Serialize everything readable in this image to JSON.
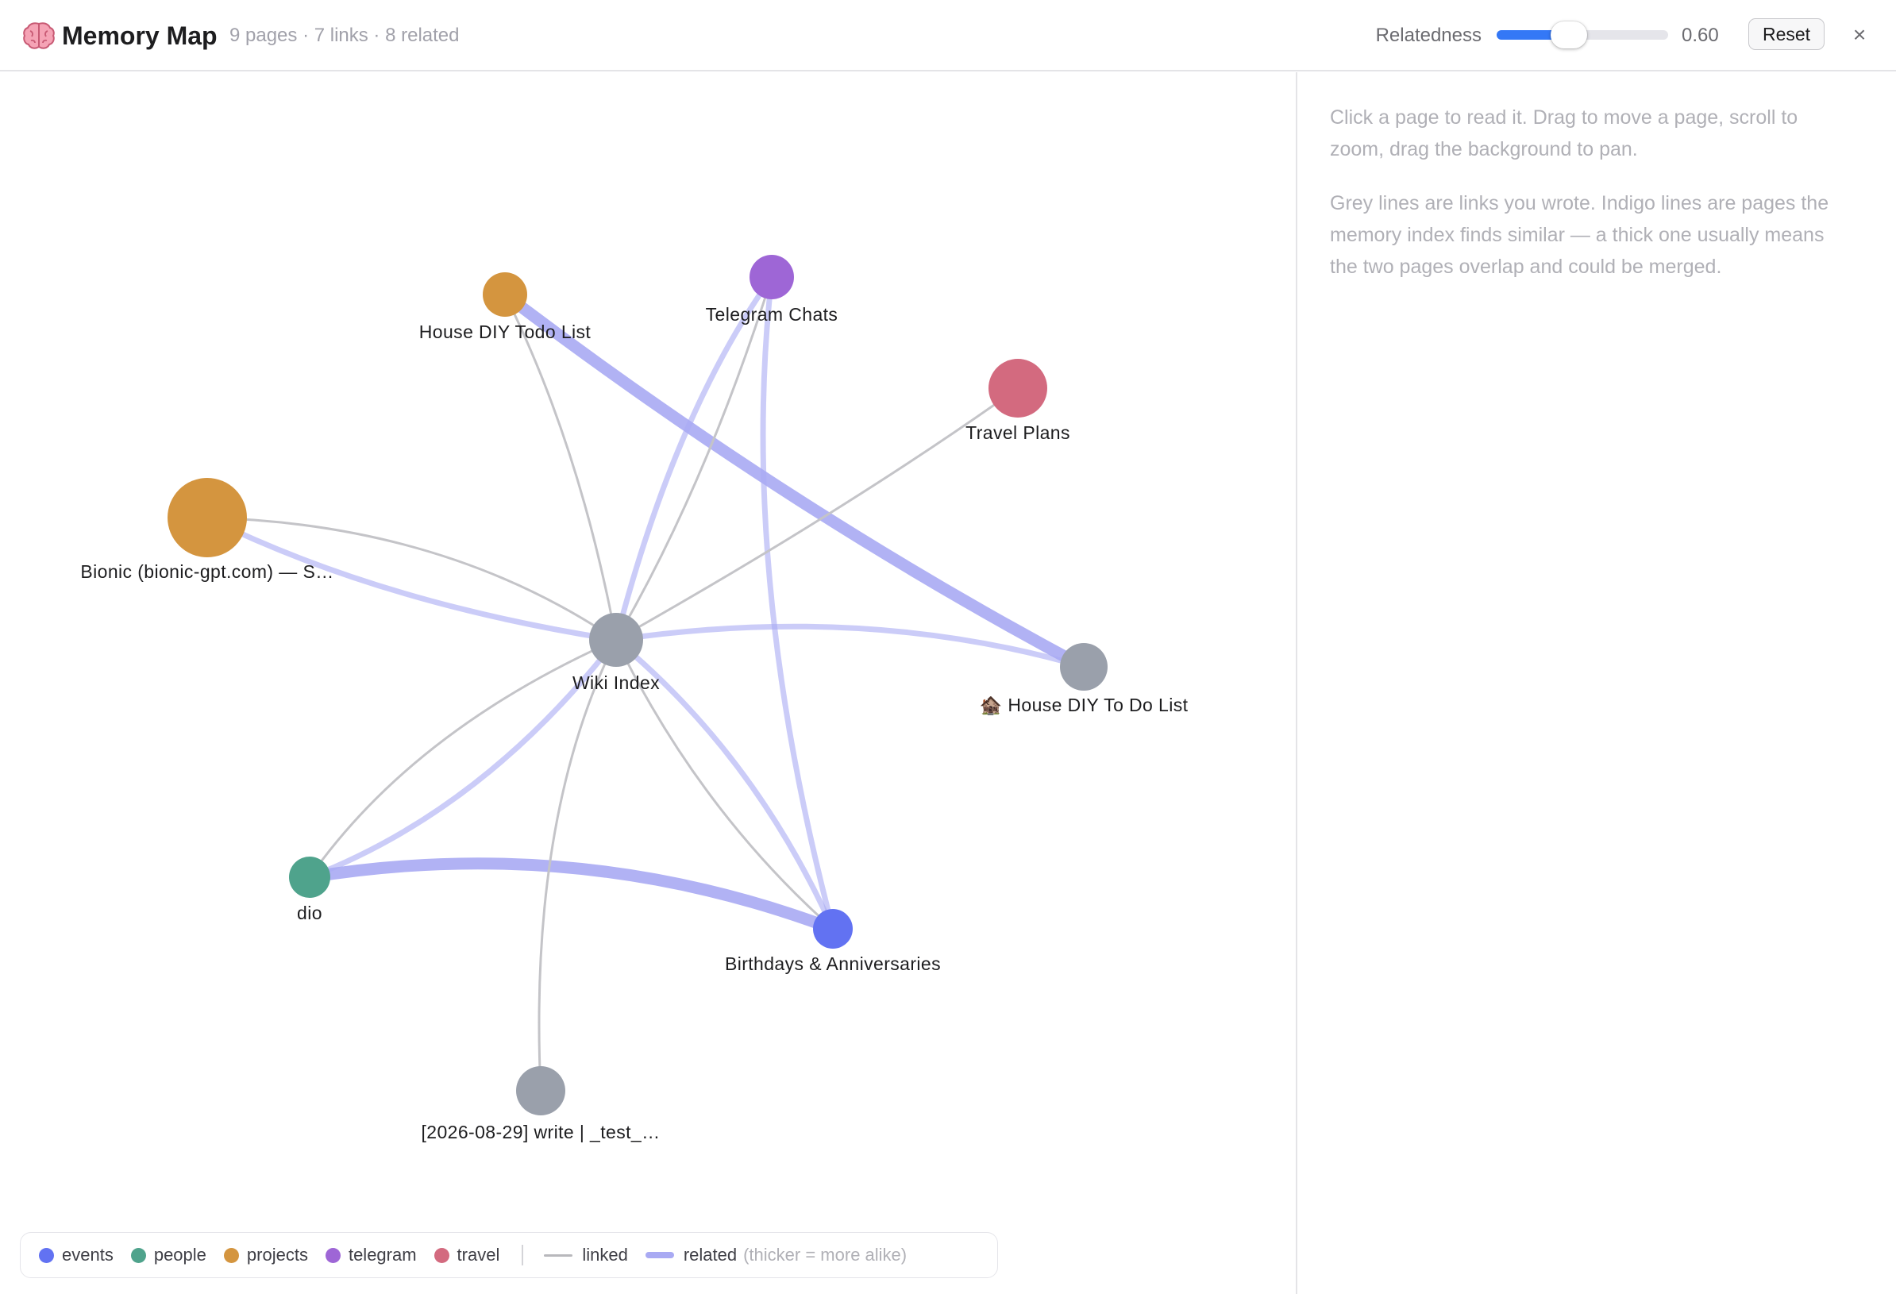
{
  "header": {
    "title": "Memory Map",
    "brain_icon": "brain-icon",
    "stats": "9 pages · 7 links · 8 related",
    "relatedness_label": "Relatedness",
    "relatedness_value": "0.60",
    "slider_fraction": 0.42,
    "reset_label": "Reset",
    "close_label": "×",
    "slider_color": "#3478f6"
  },
  "info": {
    "paragraph1": "Click a page to read it. Drag to move a page, scroll to zoom, drag the background to pan.",
    "paragraph2": "Grey lines are links you wrote. Indigo lines are pages the memory index finds similar — a thick one usually means the two pages overlap and could be merged."
  },
  "colors": {
    "events": "#6272f2",
    "people": "#4fa38c",
    "projects": "#d4953f",
    "telegram": "#9e66d6",
    "travel": "#d36a7f",
    "uncategorized": "#9aa0ab",
    "linked": "#c4c4c8",
    "related": "#a9aaf3"
  },
  "nodes": [
    {
      "id": "wiki",
      "label": "Wiki Index",
      "category": "uncategorized"
    },
    {
      "id": "todo",
      "label": "House DIY Todo List",
      "category": "projects"
    },
    {
      "id": "telegram",
      "label": "Telegram Chats",
      "category": "telegram"
    },
    {
      "id": "travel",
      "label": "Travel Plans",
      "category": "travel"
    },
    {
      "id": "bionic",
      "label": "Bionic (bionic-gpt.com) — S…",
      "category": "projects"
    },
    {
      "id": "housediy",
      "label": "🏚️ House DIY To Do List",
      "category": "uncategorized"
    },
    {
      "id": "dio",
      "label": "dio",
      "category": "people"
    },
    {
      "id": "birthdays",
      "label": "Birthdays & Anniversaries",
      "category": "events"
    },
    {
      "id": "write",
      "label": "[2026-08-29] write | _test_…",
      "category": "uncategorized"
    }
  ],
  "linked_edges": [
    {
      "from": "wiki",
      "to": "todo"
    },
    {
      "from": "wiki",
      "to": "telegram"
    },
    {
      "from": "wiki",
      "to": "travel"
    },
    {
      "from": "wiki",
      "to": "bionic"
    },
    {
      "from": "wiki",
      "to": "dio"
    },
    {
      "from": "wiki",
      "to": "birthdays"
    },
    {
      "from": "wiki",
      "to": "write"
    }
  ],
  "related_edges": [
    {
      "from": "todo",
      "to": "housediy",
      "strength": "strong"
    },
    {
      "from": "dio",
      "to": "birthdays",
      "strength": "strong"
    },
    {
      "from": "wiki",
      "to": "telegram",
      "strength": "weak"
    },
    {
      "from": "telegram",
      "to": "birthdays",
      "strength": "weak"
    },
    {
      "from": "wiki",
      "to": "bionic",
      "strength": "weak"
    },
    {
      "from": "wiki",
      "to": "housediy",
      "strength": "weak"
    },
    {
      "from": "wiki",
      "to": "dio",
      "strength": "weak"
    },
    {
      "from": "wiki",
      "to": "birthdays",
      "strength": "weak"
    }
  ],
  "legend": {
    "categories": [
      {
        "name": "events",
        "color": "#6272f2"
      },
      {
        "name": "people",
        "color": "#4fa38c"
      },
      {
        "name": "projects",
        "color": "#d4953f"
      },
      {
        "name": "telegram",
        "color": "#9e66d6"
      },
      {
        "name": "travel",
        "color": "#d36a7f"
      }
    ],
    "linked_label": "linked",
    "related_label": "related",
    "related_note": "(thicker = more alike)"
  }
}
